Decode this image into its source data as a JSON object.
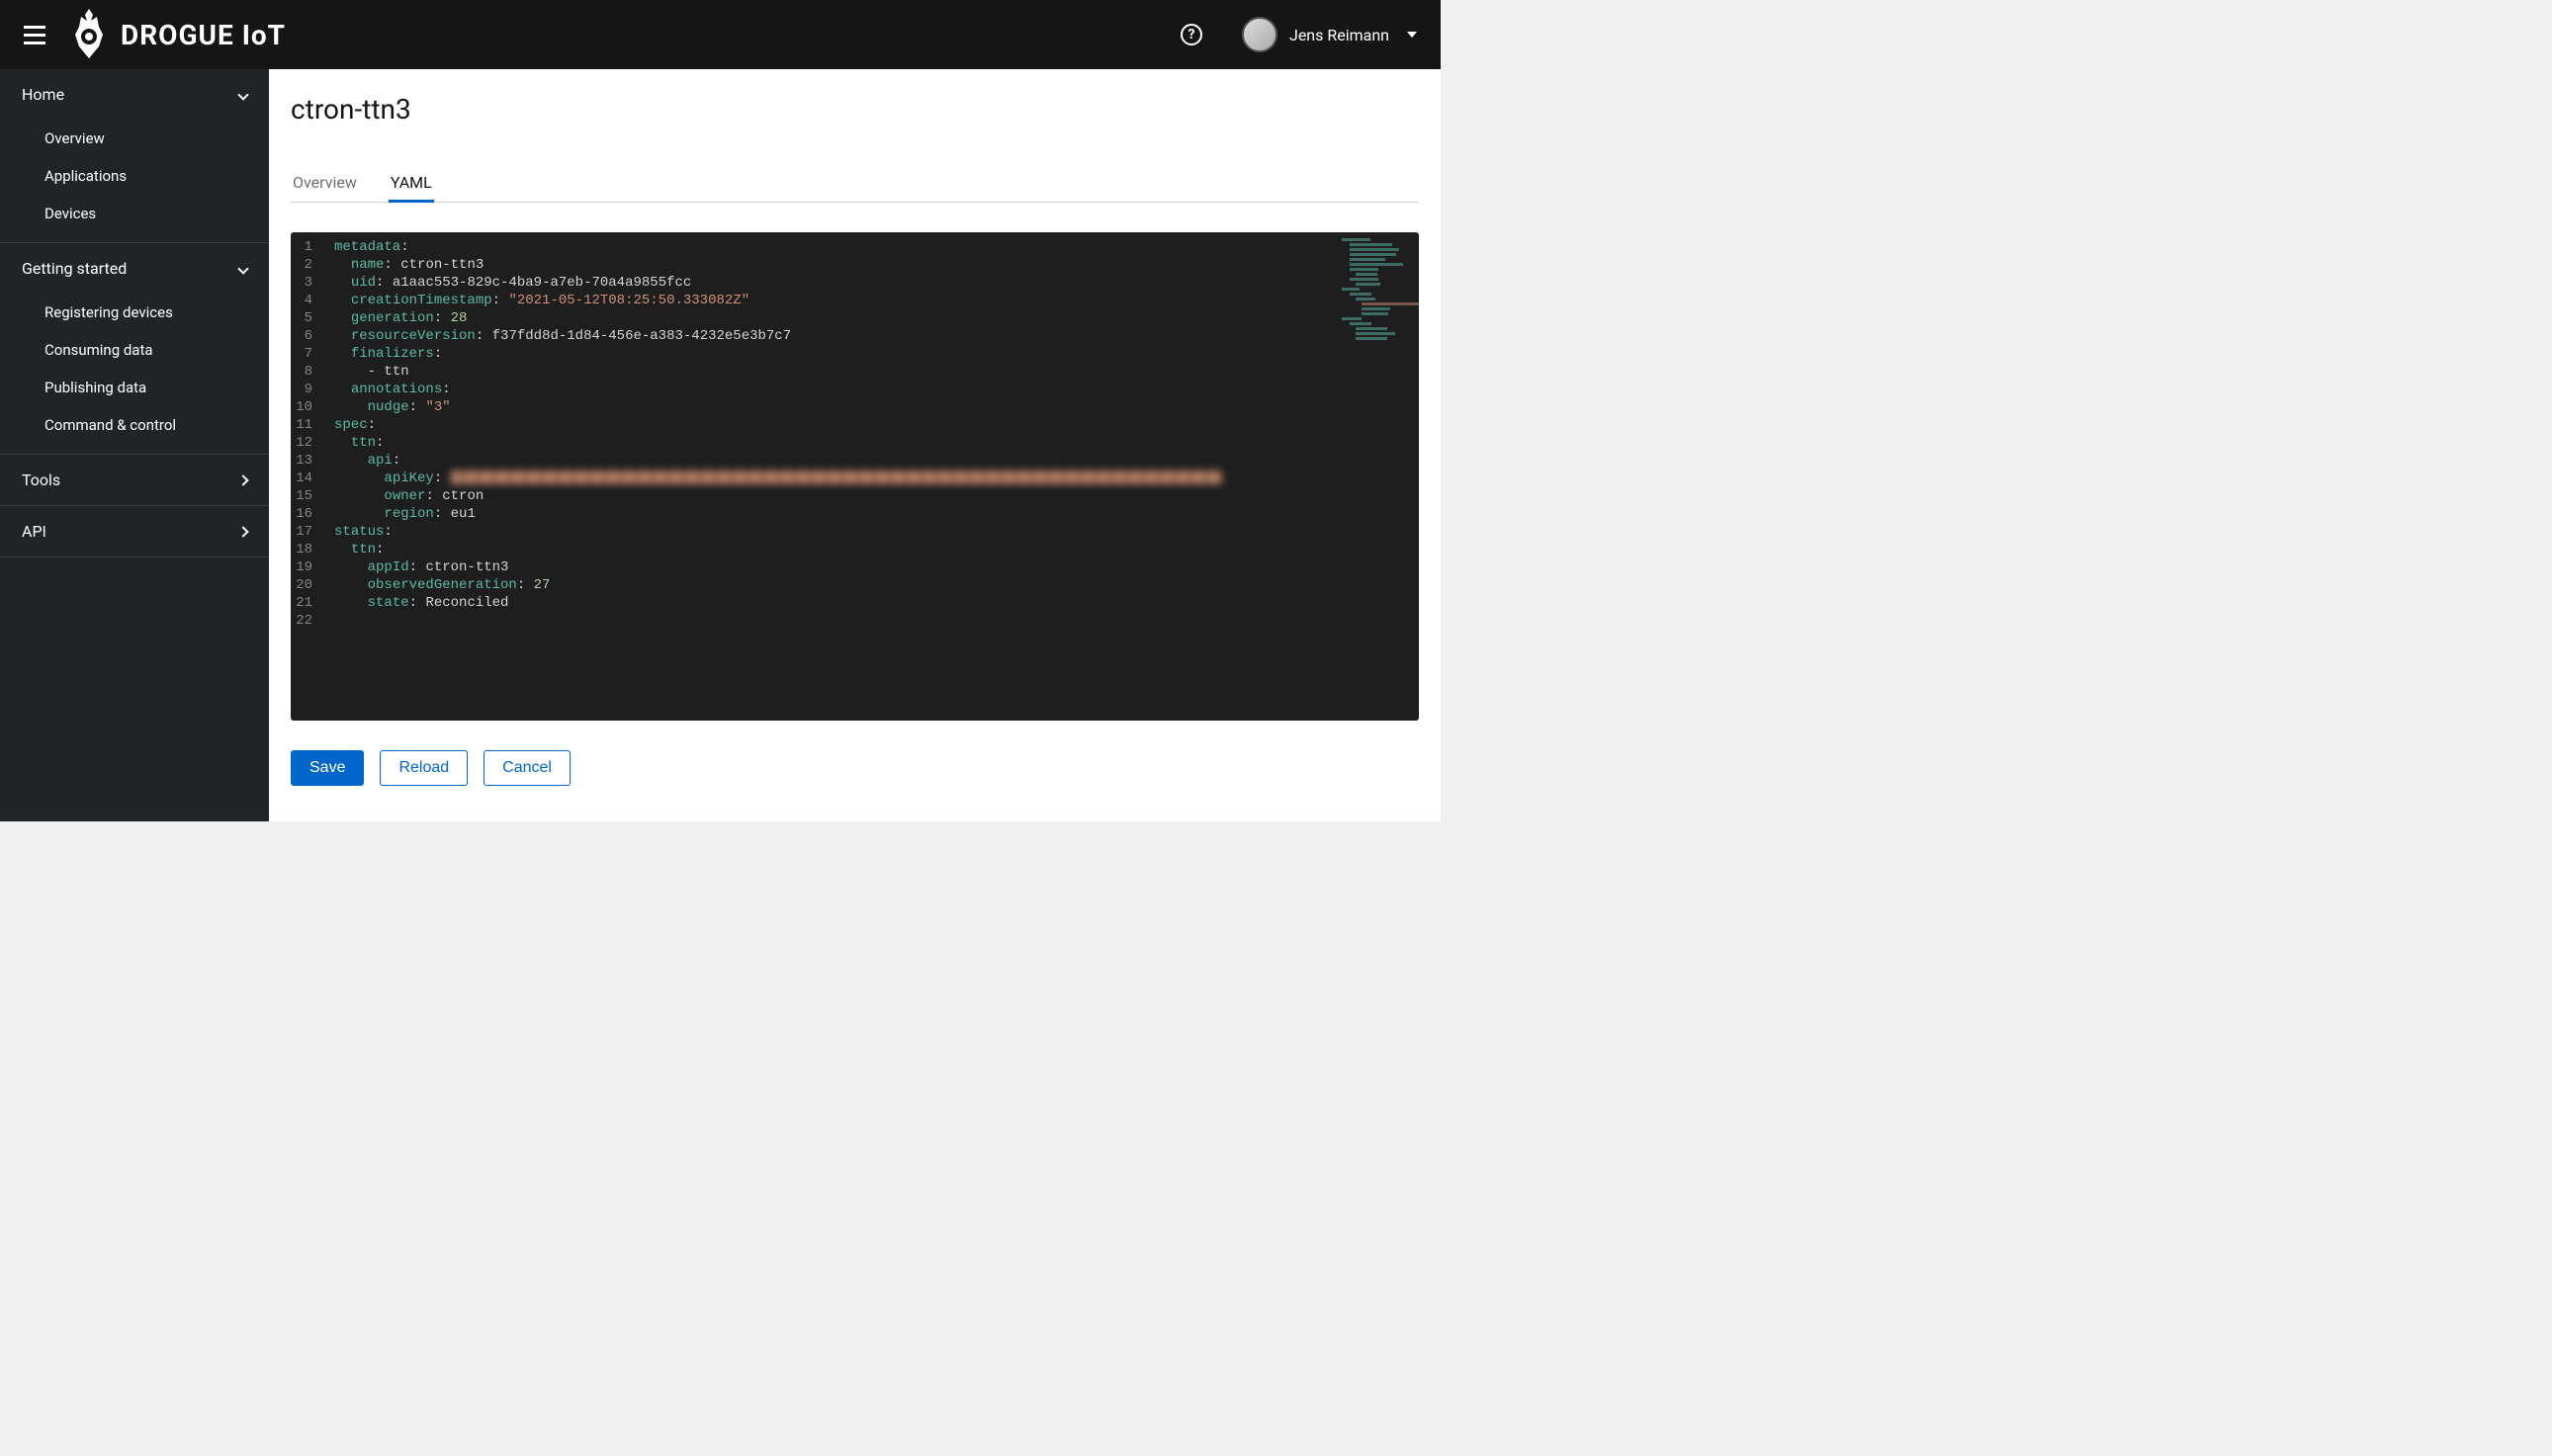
{
  "header": {
    "brand": "DROGUE IoT",
    "user_name": "Jens Reimann"
  },
  "sidebar": {
    "sections": [
      {
        "label": "Home",
        "expanded": true,
        "items": [
          "Overview",
          "Applications",
          "Devices"
        ]
      },
      {
        "label": "Getting started",
        "expanded": true,
        "items": [
          "Registering devices",
          "Consuming data",
          "Publishing data",
          "Command & control"
        ]
      },
      {
        "label": "Tools",
        "expanded": false,
        "items": []
      },
      {
        "label": "API",
        "expanded": false,
        "items": []
      }
    ]
  },
  "main": {
    "title": "ctron-ttn3",
    "tabs": [
      {
        "label": "Overview",
        "active": false
      },
      {
        "label": "YAML",
        "active": true
      }
    ],
    "yaml": {
      "metadata": {
        "name": "ctron-ttn3",
        "uid": "a1aac553-829c-4ba9-a7eb-70a4a9855fcc",
        "creationTimestamp": "2021-05-12T08:25:50.333082Z",
        "generation": 28,
        "resourceVersion": "f37fdd8d-1d84-456e-a383-4232e5e3b7c7",
        "finalizers": [
          "ttn"
        ],
        "annotations": {
          "nudge": "3"
        }
      },
      "spec": {
        "ttn": {
          "api": {
            "apiKey": "[REDACTED]",
            "owner": "ctron",
            "region": "eu1"
          }
        }
      },
      "status": {
        "ttn": {
          "appId": "ctron-ttn3",
          "observedGeneration": 27,
          "state": "Reconciled"
        }
      }
    },
    "line_count": 22,
    "actions": {
      "save": "Save",
      "reload": "Reload",
      "cancel": "Cancel"
    }
  }
}
